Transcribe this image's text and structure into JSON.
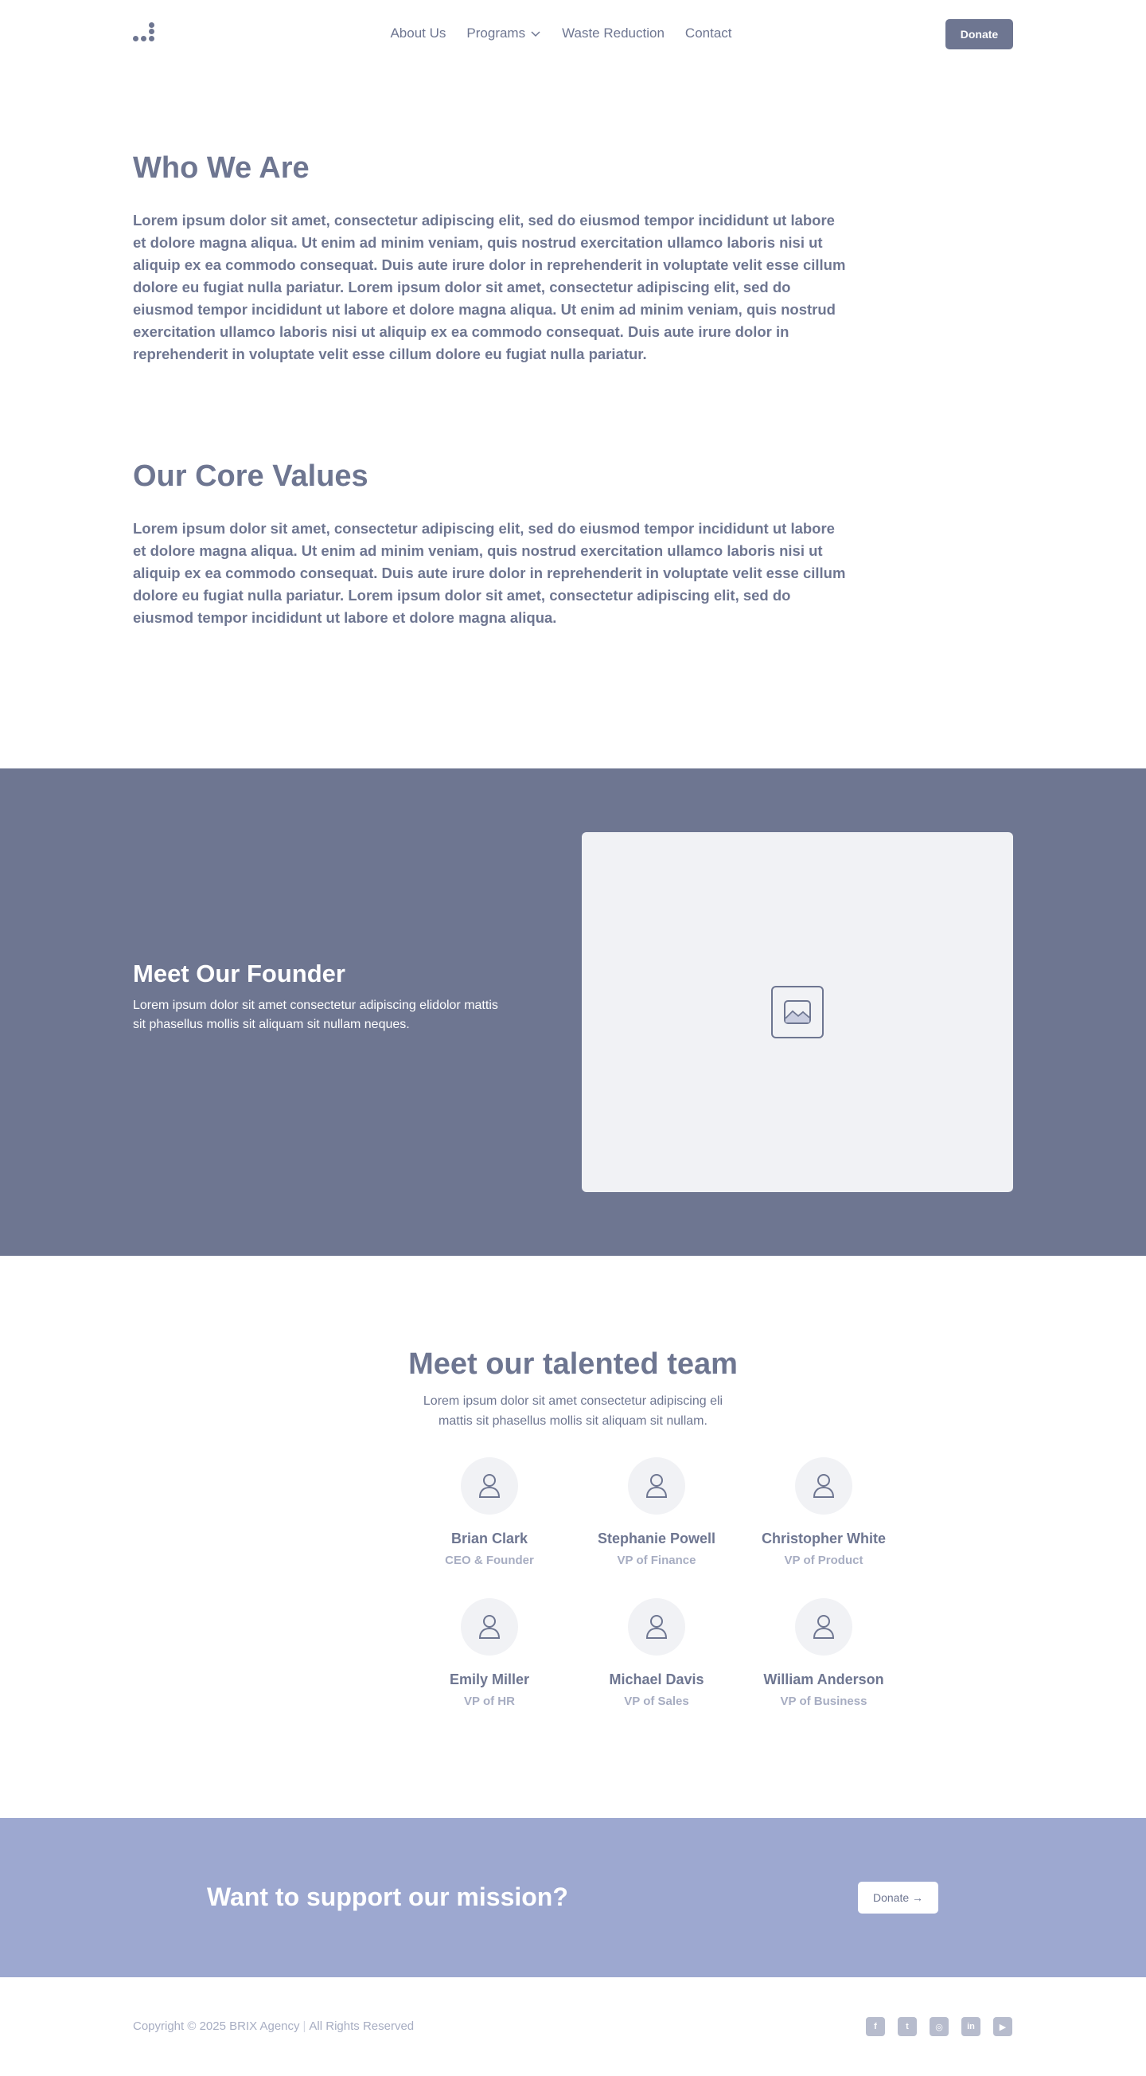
{
  "nav": {
    "links": [
      "About Us",
      "Programs",
      "Waste Reduction",
      "Contact"
    ],
    "donate_label": "Donate"
  },
  "who": {
    "title": "Who We Are",
    "body": "Lorem ipsum dolor sit amet, consectetur adipiscing elit, sed do eiusmod tempor incididunt ut labore et dolore magna aliqua. Ut enim ad minim veniam, quis nostrud exercitation ullamco laboris nisi ut aliquip ex ea commodo consequat. Duis aute irure dolor in reprehenderit in voluptate velit esse cillum dolore eu fugiat nulla pariatur. Lorem ipsum dolor sit amet, consectetur adipiscing elit, sed do eiusmod tempor incididunt ut labore et dolore magna aliqua. Ut enim ad minim veniam, quis nostrud exercitation ullamco laboris nisi ut aliquip ex ea commodo consequat. Duis aute irure dolor in reprehenderit in voluptate velit esse cillum dolore eu fugiat nulla pariatur."
  },
  "values": {
    "title": "Our Core Values",
    "body": "Lorem ipsum dolor sit amet, consectetur adipiscing elit, sed do eiusmod tempor incididunt ut labore et dolore magna aliqua. Ut enim ad minim veniam, quis nostrud exercitation ullamco laboris nisi ut aliquip ex ea commodo consequat. Duis aute irure dolor in reprehenderit in voluptate velit esse cillum dolore eu fugiat nulla pariatur. Lorem ipsum dolor sit amet, consectetur adipiscing elit, sed do eiusmod tempor incididunt ut labore et dolore magna aliqua."
  },
  "founder": {
    "title": "Meet Our Founder",
    "body": "Lorem ipsum dolor sit amet consectetur adipiscing elidolor mattis sit phasellus mollis sit aliquam sit nullam neques."
  },
  "team": {
    "title": "Meet our talented team",
    "subtitle": "Lorem ipsum dolor sit amet consectetur adipiscing eli mattis sit phasellus mollis sit aliquam sit nullam.",
    "members": [
      {
        "name": "Brian Clark",
        "role": "CEO & Founder"
      },
      {
        "name": "Stephanie Powell",
        "role": "VP of Finance"
      },
      {
        "name": "Christopher White",
        "role": "VP of Product"
      },
      {
        "name": "Emily Miller",
        "role": "VP of HR"
      },
      {
        "name": "Michael Davis",
        "role": "VP of Sales"
      },
      {
        "name": "William Anderson",
        "role": "VP of Business"
      }
    ]
  },
  "cta": {
    "title": "Want to support our mission?",
    "button_label": "Donate →"
  },
  "footer": {
    "copyright": "Copyright © 2025 BRIX Agency",
    "rights": "All Rights Reserved",
    "socials": [
      {
        "icon": "facebook-icon",
        "glyph": "f"
      },
      {
        "icon": "twitter-icon",
        "glyph": "t"
      },
      {
        "icon": "instagram-icon",
        "glyph": "◎"
      },
      {
        "icon": "linkedin-icon",
        "glyph": "in"
      },
      {
        "icon": "youtube-icon",
        "glyph": "▶"
      }
    ]
  },
  "colors": {
    "primary": "#6e7691",
    "cta_bg": "#9da8d0",
    "light_bg": "#f1f2f5",
    "muted": "#a7adc2"
  }
}
